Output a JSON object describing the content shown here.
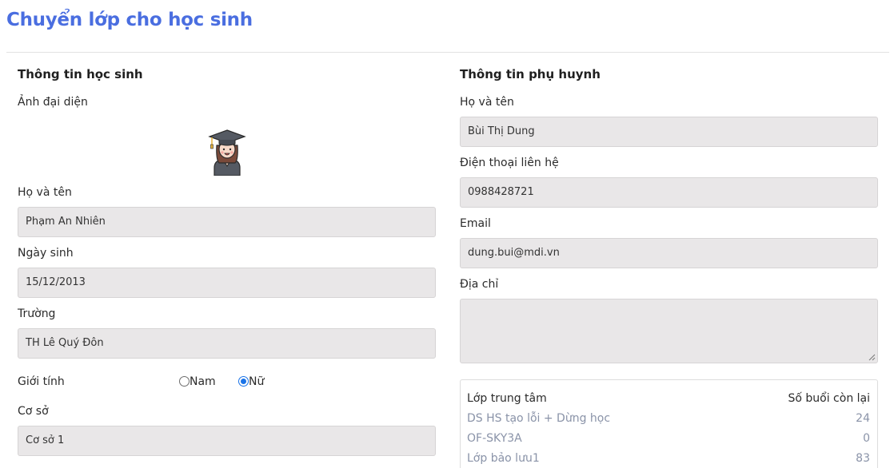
{
  "page": {
    "title": "Chuyển lớp cho học sinh"
  },
  "student": {
    "section_title": "Thông tin học sinh",
    "avatar_label": "Ảnh đại diện",
    "avatar_icon": "graduate-avatar-icon",
    "name_label": "Họ và tên",
    "name_value": "Phạm An Nhiên",
    "dob_label": "Ngày sinh",
    "dob_value": "15/12/2013",
    "school_label": "Trường",
    "school_value": "TH Lê Quý Đôn",
    "gender_label": "Giới tính",
    "gender_options": [
      {
        "label": "Nam",
        "checked": false
      },
      {
        "label": "Nữ",
        "checked": true
      }
    ],
    "campus_label": "Cơ sở",
    "campus_value": "Cơ sở 1"
  },
  "parent": {
    "section_title": "Thông tin phụ huynh",
    "name_label": "Họ và tên",
    "name_value": "Bùi Thị Dung",
    "phone_label": "Điện thoại liên hệ",
    "phone_value": "0988428721",
    "email_label": "Email",
    "email_value": "dung.bui@mdi.vn",
    "address_label": "Địa chỉ",
    "address_value": ""
  },
  "classes": {
    "header_class": "Lớp trung tâm",
    "header_sessions": "Số buổi còn lại",
    "rows": [
      {
        "name": "DS HS tạo lỗi + Dừng học",
        "remaining": "24"
      },
      {
        "name": "OF-SKY3A",
        "remaining": "0"
      },
      {
        "name": "Lớp bảo lưu1",
        "remaining": "83"
      }
    ]
  },
  "colors": {
    "title_accent": "#4a6ee0",
    "field_bg": "#e9e7e8",
    "radio_checked": "#1a73e8",
    "class_text": "#8a93a8"
  }
}
